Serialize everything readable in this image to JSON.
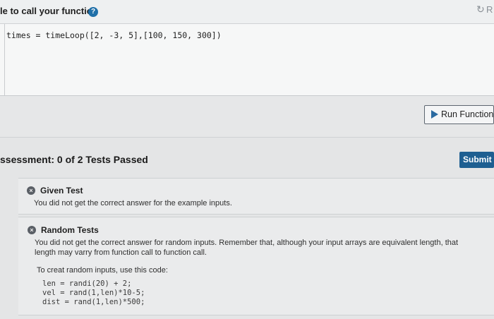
{
  "header": {
    "title": "le to call your function",
    "help_icon": "question-icon",
    "reset_icon": "reset-icon",
    "reset_text": "R"
  },
  "editor": {
    "code": "times = timeLoop([2, -3, 5],[100, 150, 300])"
  },
  "run": {
    "label": "Run Function",
    "icon": "play-icon"
  },
  "assessment": {
    "title": "ssessment: 0 of 2 Tests Passed",
    "submit_label": "Submit"
  },
  "tests": [
    {
      "title": "Given Test",
      "status_icon": "fail-icon",
      "message": "You did not get the correct answer for the example inputs."
    },
    {
      "title": "Random Tests",
      "status_icon": "fail-icon",
      "message_line1": "You did not get the correct answer for random inputs. Remember that, although your input arrays are equivalent length, that",
      "message_line2": "length may varry from function call to function call.",
      "hint": "To creat random inputs, use this code:",
      "code_line1": "len = randi(20) + 2;",
      "code_line2": "vel = rand(1,len)*10-5;",
      "code_line3": "dist = rand(1,len)*500;"
    }
  ],
  "colors": {
    "submit_bg": "#1e5f91",
    "accent_blue": "#2a6aa0"
  }
}
